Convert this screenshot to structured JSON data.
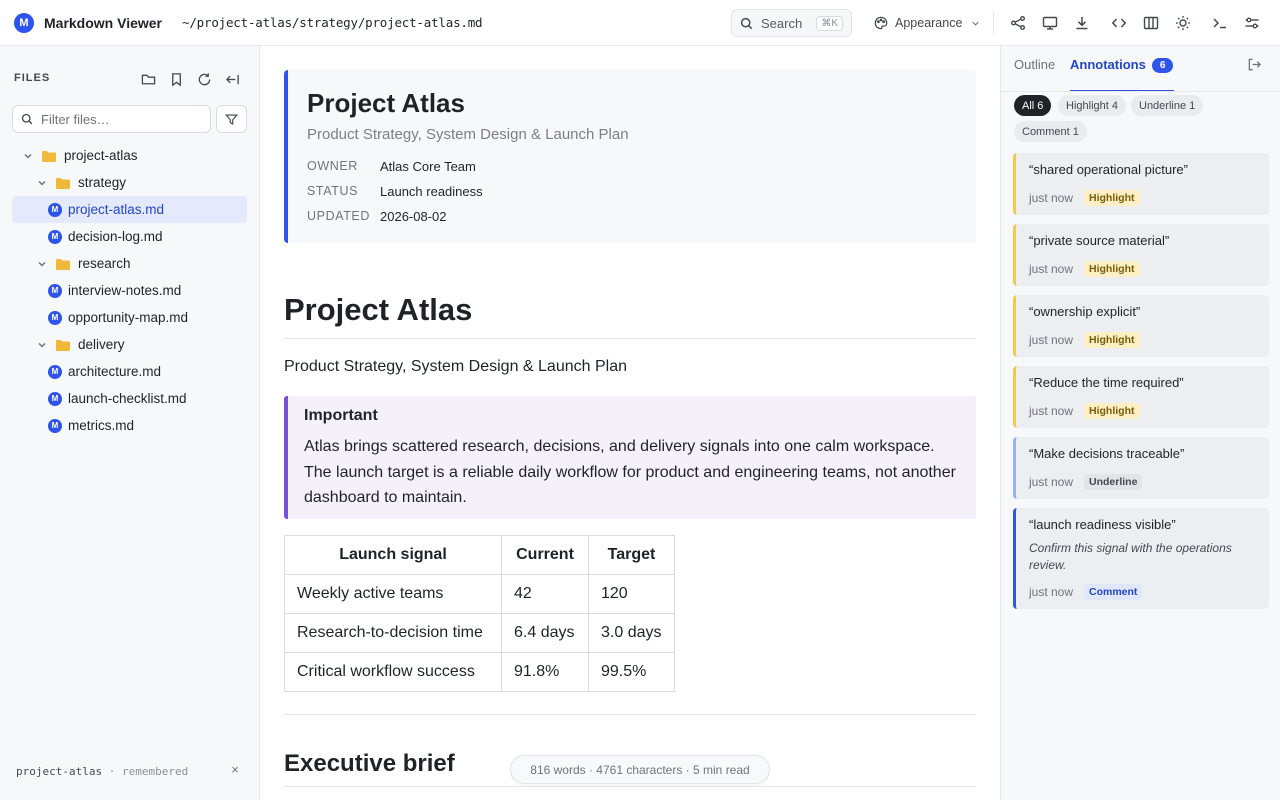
{
  "app": {
    "logo_letter": "M",
    "title": "Markdown Viewer",
    "path": "~/project-atlas/strategy/project-atlas.md"
  },
  "toolbar": {
    "search_label": "Search",
    "search_shortcut": "⌘K",
    "appearance_label": "Appearance"
  },
  "sidebar": {
    "heading": "FILES",
    "filter_placeholder": "Filter files…",
    "tree": [
      {
        "type": "folder",
        "name": "project-atlas",
        "depth": 0
      },
      {
        "type": "folder",
        "name": "strategy",
        "depth": 1
      },
      {
        "type": "file",
        "name": "project-atlas.md",
        "depth": 2,
        "active": true
      },
      {
        "type": "file",
        "name": "decision-log.md",
        "depth": 2
      },
      {
        "type": "folder",
        "name": "research",
        "depth": 1
      },
      {
        "type": "file",
        "name": "interview-notes.md",
        "depth": 2
      },
      {
        "type": "file",
        "name": "opportunity-map.md",
        "depth": 2
      },
      {
        "type": "folder",
        "name": "delivery",
        "depth": 1
      },
      {
        "type": "file",
        "name": "architecture.md",
        "depth": 2
      },
      {
        "type": "file",
        "name": "launch-checklist.md",
        "depth": 2
      },
      {
        "type": "file",
        "name": "metrics.md",
        "depth": 2
      }
    ],
    "footer_workspace": "project-atlas",
    "footer_status": "· remembered",
    "footer_close": "×"
  },
  "document": {
    "meta": {
      "title": "Project Atlas",
      "subtitle": "Product Strategy, System Design & Launch Plan",
      "rows": [
        {
          "key": "OWNER",
          "value": "Atlas Core Team"
        },
        {
          "key": "STATUS",
          "value": "Launch readiness"
        },
        {
          "key": "UPDATED",
          "value": "2026-08-02"
        }
      ]
    },
    "h1": "Project Atlas",
    "lead": "Product Strategy, System Design & Launch Plan",
    "callout": {
      "title": "Important",
      "body": "Atlas brings scattered research, decisions, and delivery signals into one calm workspace. The launch target is a reliable daily workflow for product and engineering teams, not another dashboard to maintain."
    },
    "table": {
      "headers": [
        "Launch signal",
        "Current",
        "Target"
      ],
      "rows": [
        [
          "Weekly active teams",
          "42",
          "120"
        ],
        [
          "Research-to-decision time",
          "6.4 days",
          "3.0 days"
        ],
        [
          "Critical workflow success",
          "91.8%",
          "99.5%"
        ]
      ]
    },
    "h2": "Executive brief",
    "stats": "816 words · 4761 characters · 5 min read"
  },
  "annotations_panel": {
    "tab_outline": "Outline",
    "tab_annotations": "Annotations",
    "count": "6",
    "filters": [
      {
        "label": "All 6",
        "active": true
      },
      {
        "label": "Highlight 4"
      },
      {
        "label": "Underline 1"
      },
      {
        "label": "Comment 1"
      }
    ],
    "items": [
      {
        "quote": "“shared operational picture”",
        "time": "just now",
        "kind": "Highlight"
      },
      {
        "quote": "“private source material”",
        "time": "just now",
        "kind": "Highlight"
      },
      {
        "quote": "“ownership explicit”",
        "time": "just now",
        "kind": "Highlight"
      },
      {
        "quote": "“Reduce the time required”",
        "time": "just now",
        "kind": "Highlight"
      },
      {
        "quote": "“Make decisions traceable”",
        "time": "just now",
        "kind": "Underline"
      },
      {
        "quote": "“launch readiness visible”",
        "comment": "Confirm this signal with the operations review.",
        "time": "just now",
        "kind": "Comment"
      }
    ]
  },
  "colors": {
    "accent": "#2f54eb",
    "callout_border": "#7b4fd6",
    "highlight": "#f2c94c",
    "folder": "#f0b93a"
  }
}
